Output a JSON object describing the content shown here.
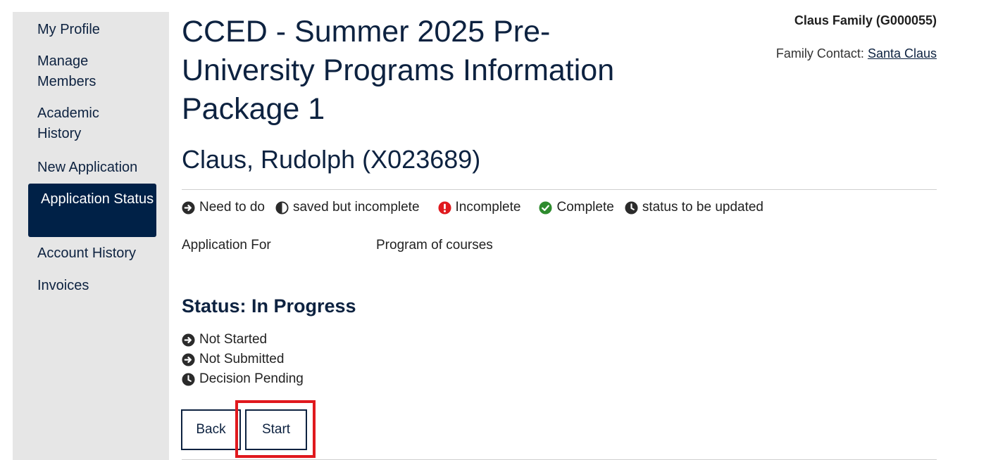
{
  "nav": {
    "my_profile": "My Profile",
    "manage_members": "Manage Members",
    "academic_history": "Academic History",
    "new_application": "New Application",
    "application_status": "Application Status",
    "account_history": "Account History",
    "invoices": "Invoices"
  },
  "header": {
    "title": "CCED - Summer 2025 Pre-University Programs Information Package 1",
    "student": "Claus, Rudolph (X023689)",
    "family": "Claus Family (G000055)",
    "contact_label": "Family Contact:",
    "contact_name": "Santa Claus"
  },
  "legend": {
    "need_to_do": "Need to do",
    "saved": "saved but incomplete",
    "incomplete": "Incomplete",
    "complete": "Complete",
    "to_update": "status to be updated"
  },
  "application": {
    "label": "Application For",
    "value": "Program of courses"
  },
  "status": {
    "heading": "Status: In Progress",
    "items": [
      "Not Started",
      "Not Submitted",
      "Decision Pending"
    ]
  },
  "actions": {
    "back": "Back",
    "start": "Start"
  },
  "colors": {
    "navy": "#002147",
    "incomplete": "#e0191e",
    "complete": "#2e8b2e",
    "highlight": "#e0191e"
  }
}
